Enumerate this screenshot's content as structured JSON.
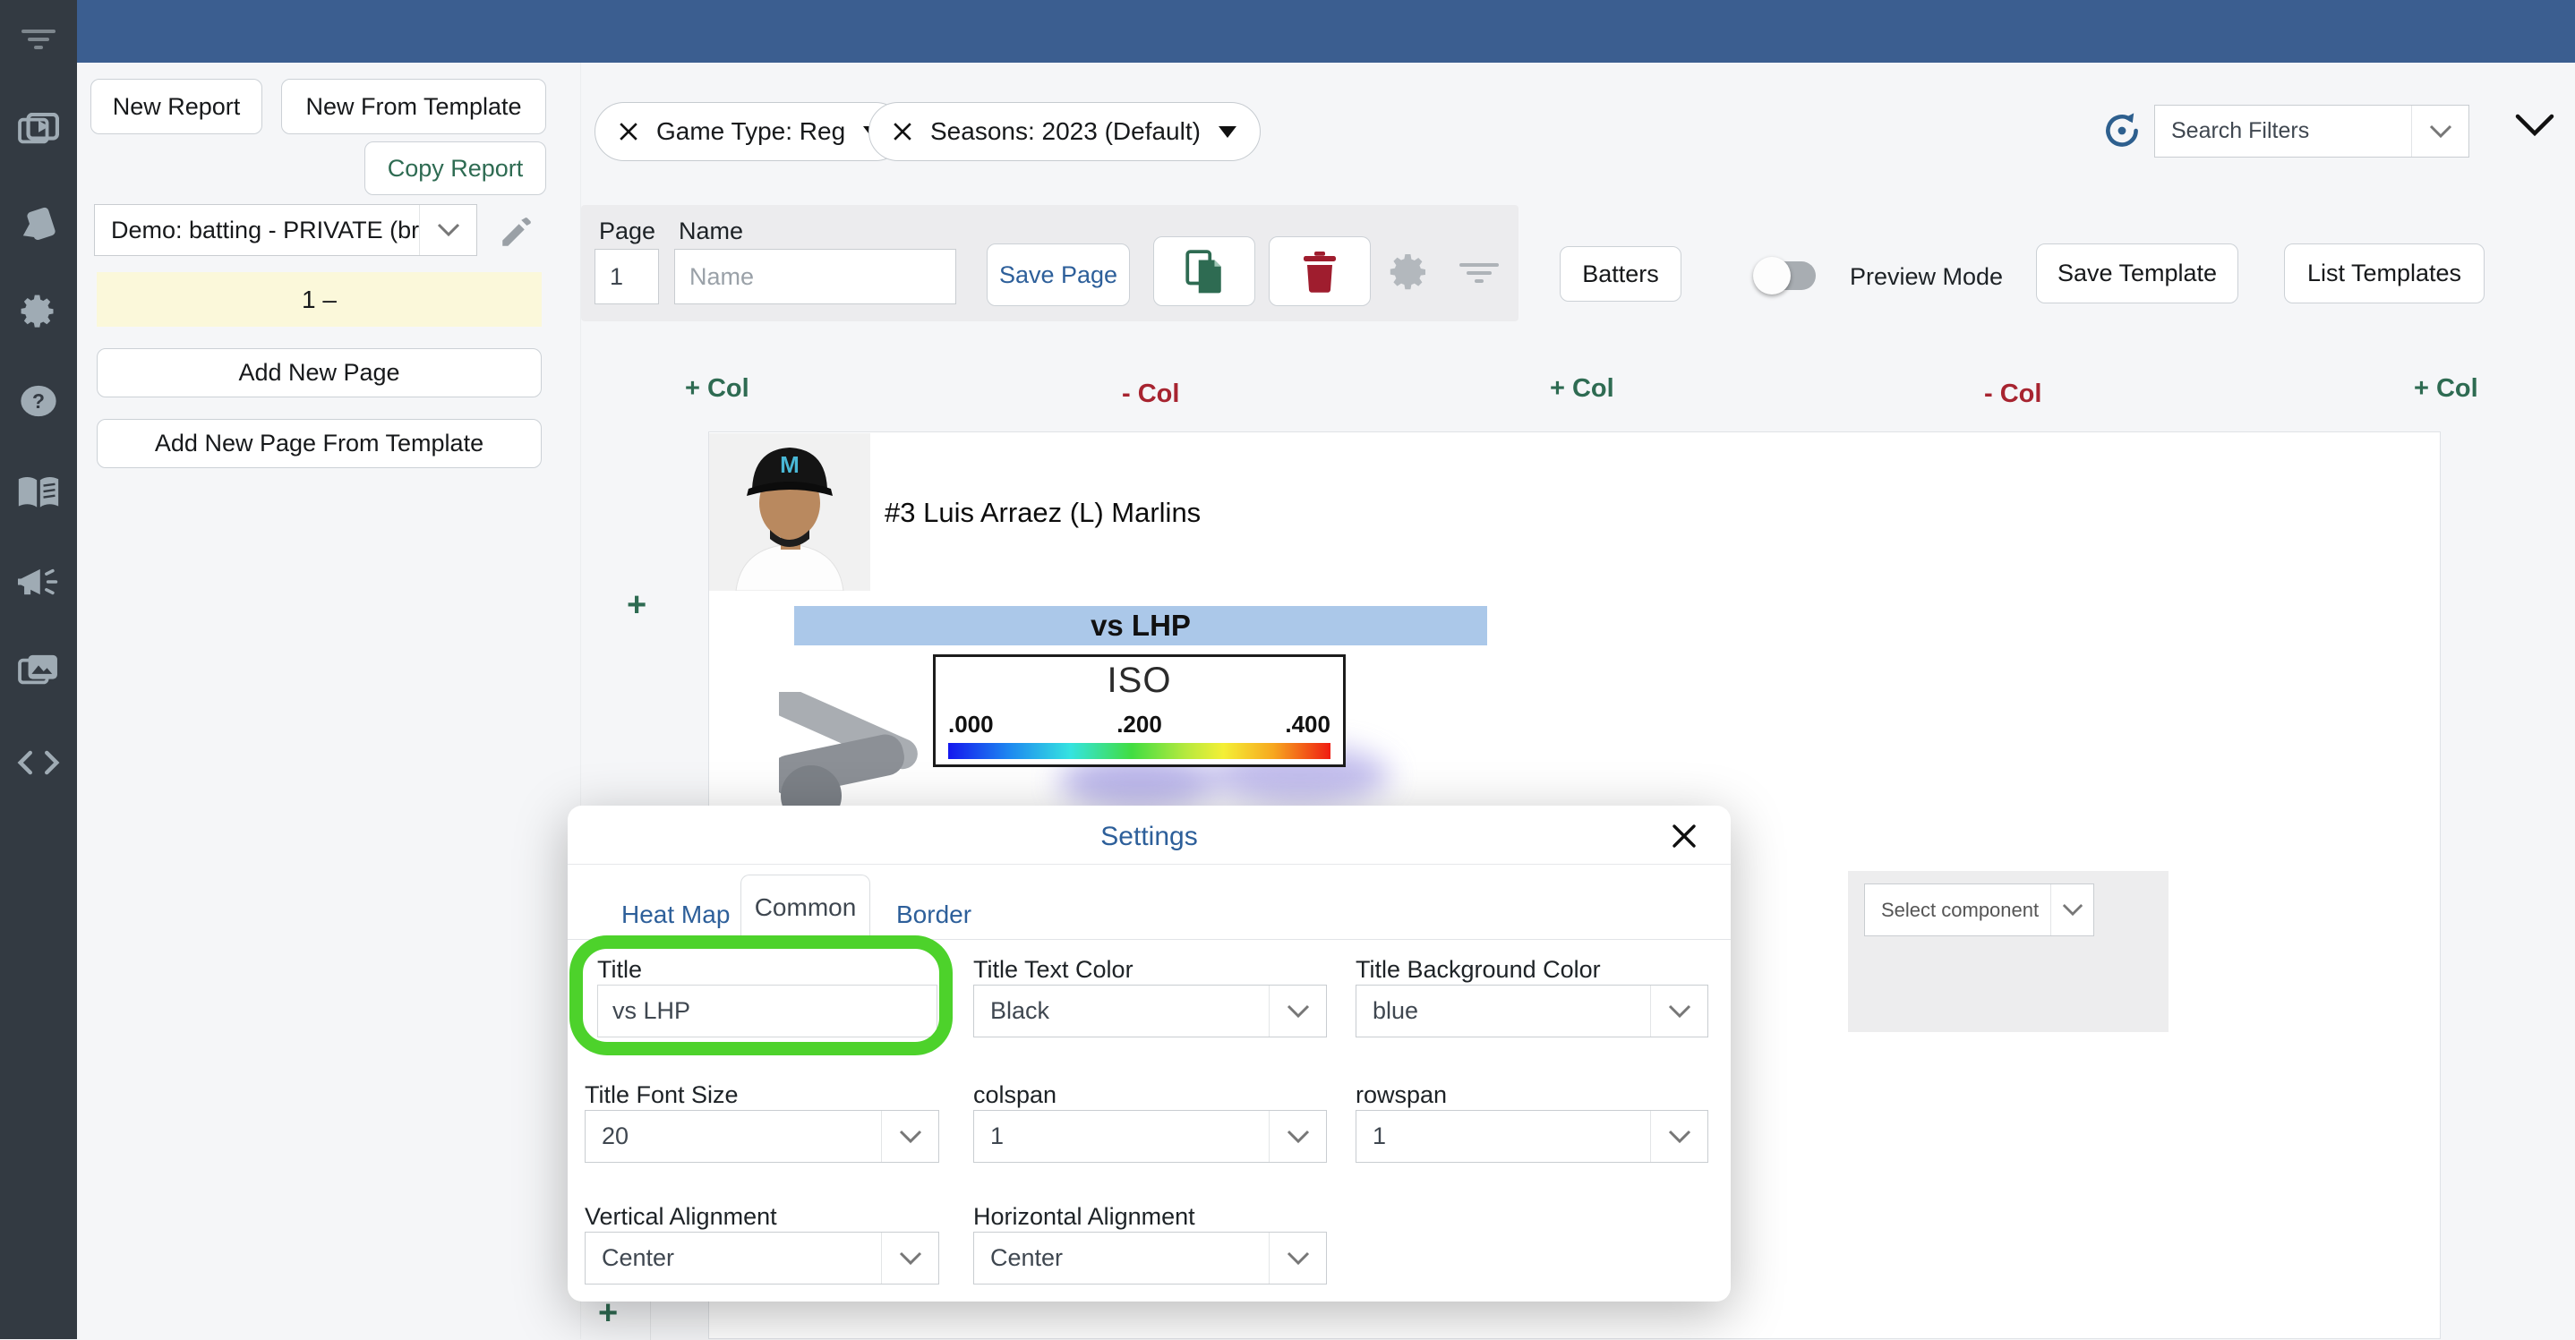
{
  "app": {
    "topbar_color": "#3b5e90",
    "sidebar_color": "#333a42",
    "accent_blue": "#2d5f9a",
    "accent_teal": "#2e6b52",
    "accent_red": "#a32430",
    "highlight_green": "#4dd22b"
  },
  "sidebar": {
    "icons": [
      "filter-menu-icon",
      "video-library-icon",
      "cards-icon",
      "settings-gear-icon",
      "help-icon",
      "book-icon",
      "megaphone-icon",
      "image-library-icon",
      "code-icon"
    ]
  },
  "left_panel": {
    "new_report": "New Report",
    "new_from_template": "New From Template",
    "copy_report": "Copy Report",
    "report_select_value": "Demo: batting - PRIVATE (brad…",
    "page_list_item": "1 –",
    "add_new_page": "Add New Page",
    "add_new_page_from_template": "Add New Page From Template"
  },
  "filter_bar": {
    "chips": [
      {
        "label": "Game Type: Reg"
      },
      {
        "label": "Seasons: 2023 (Default)"
      }
    ],
    "search_filters_value": "Search Filters"
  },
  "page_toolbar": {
    "page_label": "Page",
    "page_value": "1",
    "name_label": "Name",
    "name_placeholder": "Name",
    "save_page": "Save Page"
  },
  "actions": {
    "batters": "Batters",
    "preview_mode": "Preview Mode",
    "save_template": "Save Template",
    "list_templates": "List Templates"
  },
  "col_controls": [
    "+ Col",
    "- Col",
    "+ Col",
    "- Col",
    "+ Col"
  ],
  "report": {
    "add_row": "+",
    "add_row_bottom": "+",
    "player_name": "#3 Luis Arraez (L) Marlins",
    "banner_title": "vs LHP",
    "banner_bg": "#abc8e9",
    "legend": {
      "title": "ISO",
      "ticks": [
        ".000",
        ".200",
        ".400"
      ]
    },
    "select_component": "Select component"
  },
  "modal": {
    "title": "Settings",
    "tabs": [
      "Heat Map",
      "Common",
      "Border"
    ],
    "active_tab": "Common",
    "fields": {
      "title": {
        "label": "Title",
        "value": "vs LHP"
      },
      "text_color": {
        "label": "Title Text Color",
        "value": "Black"
      },
      "bg_color": {
        "label": "Title Background Color",
        "value": "blue"
      },
      "font_size": {
        "label": "Title Font Size",
        "value": "20"
      },
      "colspan": {
        "label": "colspan",
        "value": "1"
      },
      "rowspan": {
        "label": "rowspan",
        "value": "1"
      },
      "valign": {
        "label": "Vertical Alignment",
        "value": "Center"
      },
      "halign": {
        "label": "Horizontal Alignment",
        "value": "Center"
      }
    }
  }
}
